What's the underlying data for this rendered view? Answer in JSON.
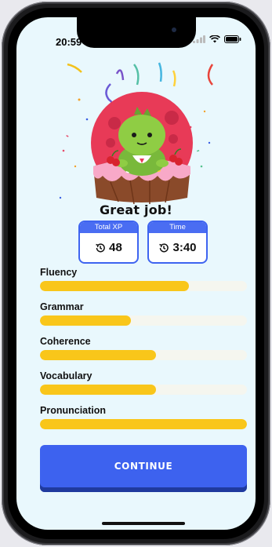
{
  "status_bar": {
    "time": "20:59"
  },
  "result": {
    "title": "Great job!"
  },
  "stats": [
    {
      "label": "Total XP",
      "value": "48",
      "icon": "history-icon"
    },
    {
      "label": "Time",
      "value": "3:40",
      "icon": "history-icon"
    }
  ],
  "skills": [
    {
      "label": "Fluency",
      "progress": 0.72
    },
    {
      "label": "Grammar",
      "progress": 0.44
    },
    {
      "label": "Coherence",
      "progress": 0.56
    },
    {
      "label": "Vocabulary",
      "progress": 0.56
    },
    {
      "label": "Pronunciation",
      "progress": 1.0
    }
  ],
  "continue_label": "CONTINUE",
  "colors": {
    "accent": "#3d62ef",
    "progress": "#f9c61a",
    "background": "#e9f8fd"
  }
}
